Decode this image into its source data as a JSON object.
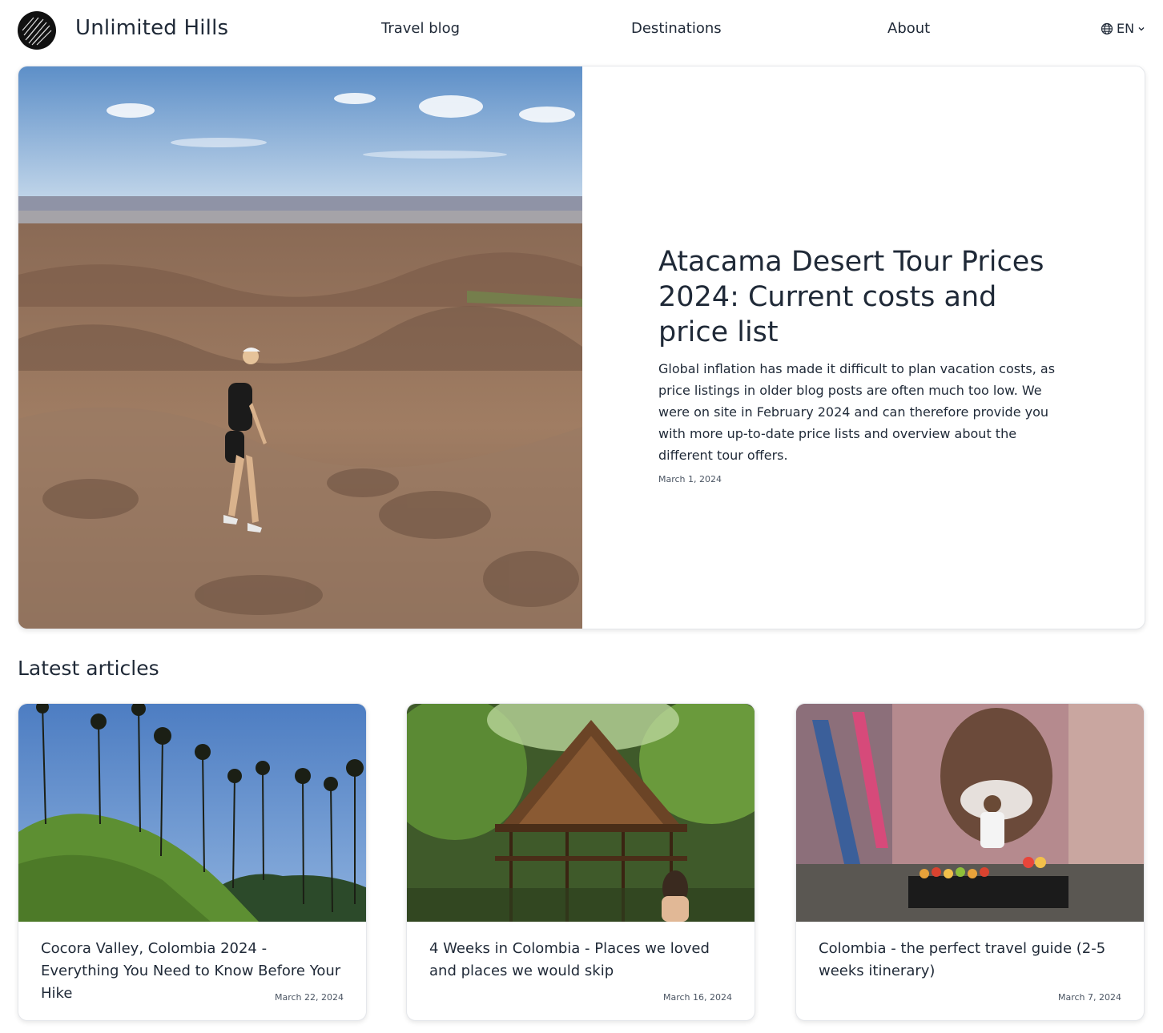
{
  "header": {
    "brand": "Unlimited Hills",
    "nav": [
      {
        "label": "Travel blog"
      },
      {
        "label": "Destinations"
      },
      {
        "label": "About"
      }
    ],
    "language": {
      "label": "EN",
      "icon": "globe-icon"
    }
  },
  "hero": {
    "title": "Atacama Desert Tour Prices 2024: Current costs and price list",
    "description": "Global inflation has made it difficult to plan vacation costs, as price listings in older blog posts are often much too low. We were on site in February 2024 and can therefore provide you with more up-to-date price lists and overview about the different tour offers.",
    "date": "March 1, 2024"
  },
  "latest": {
    "heading": "Latest articles",
    "articles": [
      {
        "title": "Cocora Valley, Colombia 2024 - Everything You Need to Know Before Your Hike",
        "date": "March 22, 2024"
      },
      {
        "title": "4 Weeks in Colombia - Places we loved and places we would skip",
        "date": "March 16, 2024"
      },
      {
        "title": "Colombia - the perfect travel guide (2-5 weeks itinerary)",
        "date": "March 7, 2024"
      }
    ]
  }
}
